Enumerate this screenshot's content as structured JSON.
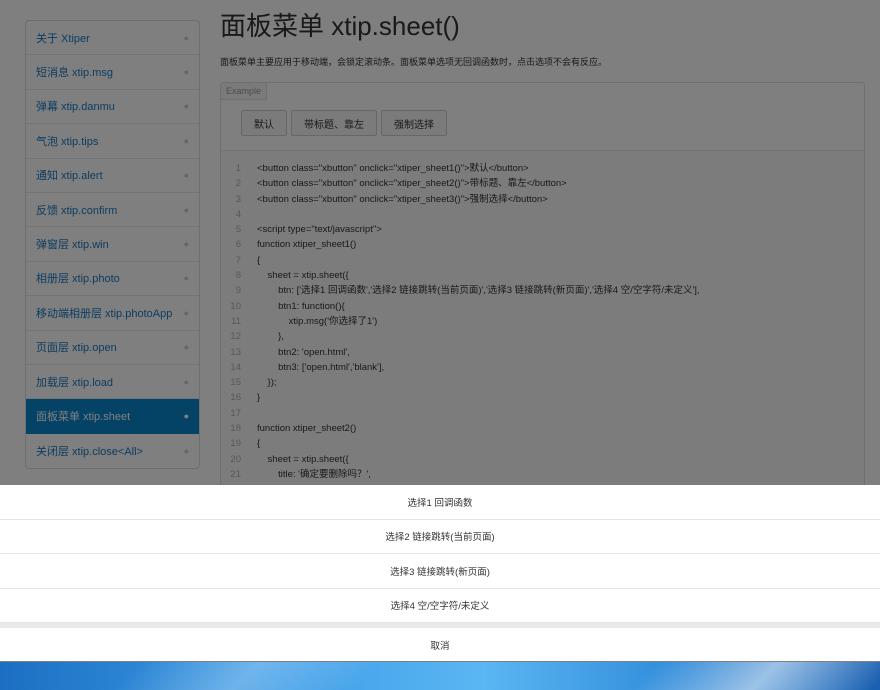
{
  "sidebar": {
    "items": [
      {
        "label": "关于 Xtiper"
      },
      {
        "label": "短消息 xtip.msg"
      },
      {
        "label": "弹幕 xtip.danmu"
      },
      {
        "label": "气泡 xtip.tips"
      },
      {
        "label": "通知 xtip.alert"
      },
      {
        "label": "反馈 xtip.confirm"
      },
      {
        "label": "弹窗层 xtip.win"
      },
      {
        "label": "相册层 xtip.photo"
      },
      {
        "label": "移动端相册层 xtip.photoApp"
      },
      {
        "label": "页面层 xtip.open"
      },
      {
        "label": "加载层 xtip.load"
      },
      {
        "label": "面板菜单 xtip.sheet",
        "active": true
      },
      {
        "label": "关闭层 xtip.close<All>"
      }
    ]
  },
  "main": {
    "title": "面板菜单 xtip.sheet()",
    "description": "面板菜单主要应用于移动端，会锁定滚动条。面板菜单选项无回调函数时，点击选项不会有反应。",
    "example_label": "Example",
    "buttons": [
      {
        "label": "默认"
      },
      {
        "label": "带标题、靠左"
      },
      {
        "label": "强制选择"
      }
    ],
    "code_lines": [
      {
        "num": "1",
        "text": "<button class=\"xbutton\" onclick=\"xtiper_sheet1()\">默认</button>"
      },
      {
        "num": "2",
        "text": "<button class=\"xbutton\" onclick=\"xtiper_sheet2()\">带标题、靠左</button>"
      },
      {
        "num": "3",
        "text": "<button class=\"xbutton\" onclick=\"xtiper_sheet3()\">强制选择</button>"
      },
      {
        "num": "4",
        "text": ""
      },
      {
        "num": "5",
        "text": "<script type=\"text/javascript\">"
      },
      {
        "num": "6",
        "text": "function xtiper_sheet1()"
      },
      {
        "num": "7",
        "text": "{"
      },
      {
        "num": "8",
        "text": "    sheet = xtip.sheet({"
      },
      {
        "num": "9",
        "text": "        btn: ['选择1 回调函数','选择2 链接跳转(当前页面)','选择3 链接跳转(新页面)','选择4 空/空字符/未定义'],"
      },
      {
        "num": "10",
        "text": "        btn1: function(){"
      },
      {
        "num": "11",
        "text": "            xtip.msg('你选择了1')"
      },
      {
        "num": "12",
        "text": "        },"
      },
      {
        "num": "13",
        "text": "        btn2: 'open.html',"
      },
      {
        "num": "14",
        "text": "        btn3: ['open.html','blank'],"
      },
      {
        "num": "15",
        "text": "    });"
      },
      {
        "num": "16",
        "text": "}"
      },
      {
        "num": "17",
        "text": ""
      },
      {
        "num": "18",
        "text": "function xtiper_sheet2()"
      },
      {
        "num": "19",
        "text": "{"
      },
      {
        "num": "20",
        "text": "    sheet = xtip.sheet({"
      },
      {
        "num": "21",
        "text": "        title: '确定要删除吗？',"
      }
    ]
  },
  "sheet": {
    "options": [
      {
        "label": "选择1 回调函数"
      },
      {
        "label": "选择2 链接跳转(当前页面)"
      },
      {
        "label": "选择3 链接跳转(新页面)"
      },
      {
        "label": "选择4 空/空字符/未定义"
      }
    ],
    "cancel_label": "取消"
  },
  "colors": {
    "accent": "#0a86cc",
    "link": "#1a78c2",
    "overlay": "rgba(0,0,0,0.5)"
  }
}
